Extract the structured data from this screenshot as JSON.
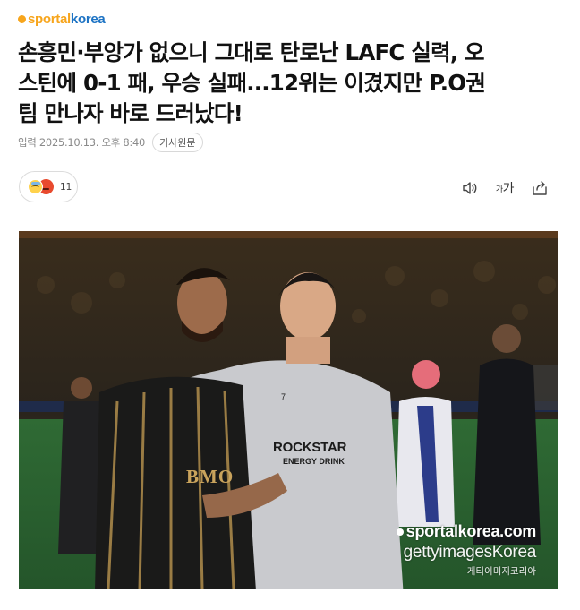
{
  "brand": {
    "part1": "sportal",
    "part2": "korea"
  },
  "headline": {
    "lines": [
      "손흥민·부앙가 없으니 그대로 탄로난 LAFC 실력, 오",
      "스틴에 0-1 패, 우승 실패...12위는 이겼지만 P.O권",
      "팀 만나자 바로 드러났다!"
    ]
  },
  "meta": {
    "date": "입력 2025.10.13. 오후 8:40",
    "original_label": "기사원문"
  },
  "reaction": {
    "count": "11",
    "icons": [
      "sad-face-icon",
      "angry-face-icon"
    ]
  },
  "tools": {
    "font_label_small": "가",
    "font_label_large": "가",
    "icons": [
      "speaker-icon",
      "font-size-icon",
      "share-icon"
    ]
  },
  "photo": {
    "watermark_main": "sportalkorea.com",
    "watermark_getty": "gettyimagesKorea",
    "watermark_sub": "게티이미지코리아",
    "jersey_sponsor_left": "BMO",
    "jersey_sponsor_right": "ROCKSTAR",
    "jersey_sponsor_right_sub": "ENERGY DRINK",
    "jersey_number": "7"
  },
  "colors": {
    "brand_orange": "#f7a51c",
    "brand_blue": "#1d73c4",
    "text": "#111111",
    "muted": "#8a8a8a"
  }
}
